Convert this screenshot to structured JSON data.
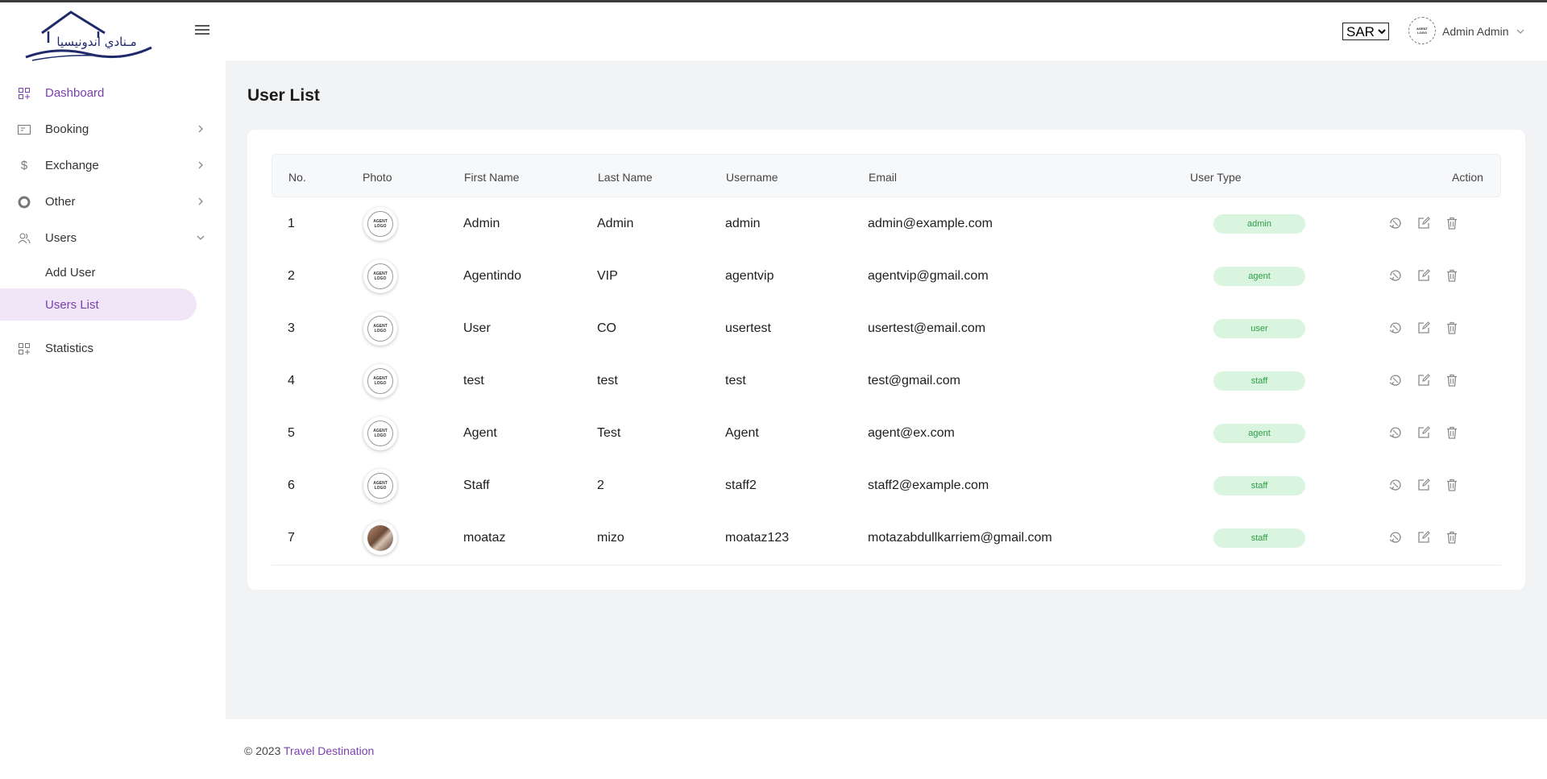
{
  "app": {
    "logo_text": "مـنادي اندونيسيا"
  },
  "header": {
    "currency": "SAR",
    "currency_options": [
      "SAR"
    ],
    "user_name": "Admin Admin",
    "avatar_text": "AGENT LOGO"
  },
  "sidebar": {
    "items": [
      {
        "label": "Dashboard",
        "icon": "dashboard-icon",
        "active": true
      },
      {
        "label": "Booking",
        "icon": "ticket-icon",
        "has_children": true
      },
      {
        "label": "Exchange",
        "icon": "dollar-icon",
        "has_children": true
      },
      {
        "label": "Other",
        "icon": "circle-icon",
        "has_children": true
      },
      {
        "label": "Users",
        "icon": "users-icon",
        "expanded": true
      }
    ],
    "users_children": [
      {
        "label": "Add User"
      },
      {
        "label": "Users List",
        "selected": true
      }
    ],
    "statistics": {
      "label": "Statistics",
      "icon": "grid-plus-icon"
    }
  },
  "main": {
    "title": "User List",
    "columns": [
      "No.",
      "Photo",
      "First Name",
      "Last Name",
      "Username",
      "Email",
      "User Type",
      "Action"
    ],
    "rows": [
      {
        "no": "1",
        "photo": "AGENT LOGO",
        "first": "Admin",
        "last": "Admin",
        "username": "admin",
        "email": "admin@example.com",
        "type": "admin"
      },
      {
        "no": "2",
        "photo": "AGENT LOGO",
        "first": "Agentindo",
        "last": "VIP",
        "username": "agentvip",
        "email": "agentvip@gmail.com",
        "type": "agent"
      },
      {
        "no": "3",
        "photo": "AGENT LOGO",
        "first": "User",
        "last": "CO",
        "username": "usertest",
        "email": "usertest@email.com",
        "type": "user"
      },
      {
        "no": "4",
        "photo": "AGENT LOGO",
        "first": "test",
        "last": "test",
        "username": "test",
        "email": "test@gmail.com",
        "type": "staff"
      },
      {
        "no": "5",
        "photo": "AGENT LOGO",
        "first": "Agent",
        "last": "Test",
        "username": "Agent",
        "email": "agent@ex.com",
        "type": "agent"
      },
      {
        "no": "6",
        "photo": "AGENT LOGO",
        "first": "Staff",
        "last": "2",
        "username": "staff2",
        "email": "staff2@example.com",
        "type": "staff"
      },
      {
        "no": "7",
        "photo": "",
        "first": "moataz",
        "last": "mizo",
        "username": "moataz123",
        "email": "motazabdullkarriem@gmail.com",
        "type": "staff"
      }
    ],
    "action_icons": [
      "reset-icon",
      "edit-icon",
      "trash-icon"
    ]
  },
  "footer": {
    "prefix": "© 2023 ",
    "link": "Travel Destination"
  },
  "colors": {
    "accent": "#7a3fb0",
    "badge_bg": "#d9f5df",
    "badge_text": "#2e9c47",
    "page_bg": "#f2f3f5"
  }
}
